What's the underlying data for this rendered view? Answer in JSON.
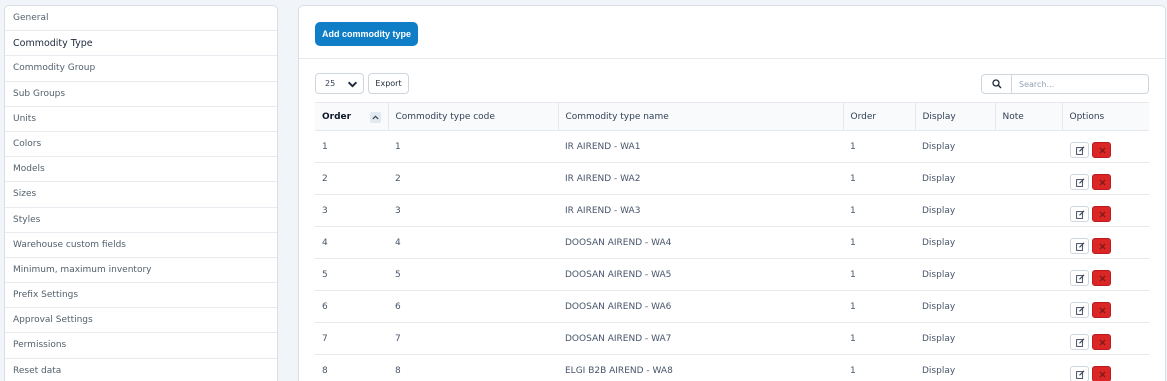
{
  "sidebar": {
    "items": [
      {
        "label": "General"
      },
      {
        "label": "Commodity Type"
      },
      {
        "label": "Commodity Group"
      },
      {
        "label": "Sub Groups"
      },
      {
        "label": "Units"
      },
      {
        "label": "Colors"
      },
      {
        "label": "Models"
      },
      {
        "label": "Sizes"
      },
      {
        "label": "Styles"
      },
      {
        "label": "Warehouse custom fields"
      },
      {
        "label": "Minimum, maximum inventory"
      },
      {
        "label": "Prefix Settings"
      },
      {
        "label": "Approval Settings"
      },
      {
        "label": "Permissions"
      },
      {
        "label": "Reset data"
      }
    ]
  },
  "main": {
    "add_button": "Add commodity type",
    "page_length": "25",
    "export_button": "Export",
    "search_placeholder": "Search..."
  },
  "table": {
    "headers": [
      "Order",
      "Commodity type code",
      "Commodity type name",
      "Order",
      "Display",
      "Note",
      "Options"
    ],
    "rows": [
      [
        "1",
        "1",
        "IR AIREND - WA1",
        "1",
        "Display",
        ""
      ],
      [
        "2",
        "2",
        "IR AIREND - WA2",
        "1",
        "Display",
        ""
      ],
      [
        "3",
        "3",
        "IR AIREND - WA3",
        "1",
        "Display",
        ""
      ],
      [
        "4",
        "4",
        "DOOSAN AIREND - WA4",
        "1",
        "Display",
        ""
      ],
      [
        "5",
        "5",
        "DOOSAN AIREND - WA5",
        "1",
        "Display",
        ""
      ],
      [
        "6",
        "6",
        "DOOSAN AIREND - WA6",
        "1",
        "Display",
        ""
      ],
      [
        "7",
        "7",
        "DOOSAN AIREND - WA7",
        "1",
        "Display",
        ""
      ],
      [
        "8",
        "8",
        "ELGI B2B AIREND - WA8",
        "1",
        "Display",
        ""
      ]
    ]
  },
  "icons": {
    "search": "search-icon",
    "sort": "chevron-up-icon",
    "select": "chevron-down-icon",
    "edit": "edit-icon",
    "delete": "close-icon"
  },
  "colors": {
    "primary": "#0f7ec7",
    "danger": "#dc2626",
    "background": "#f1f5f9"
  }
}
